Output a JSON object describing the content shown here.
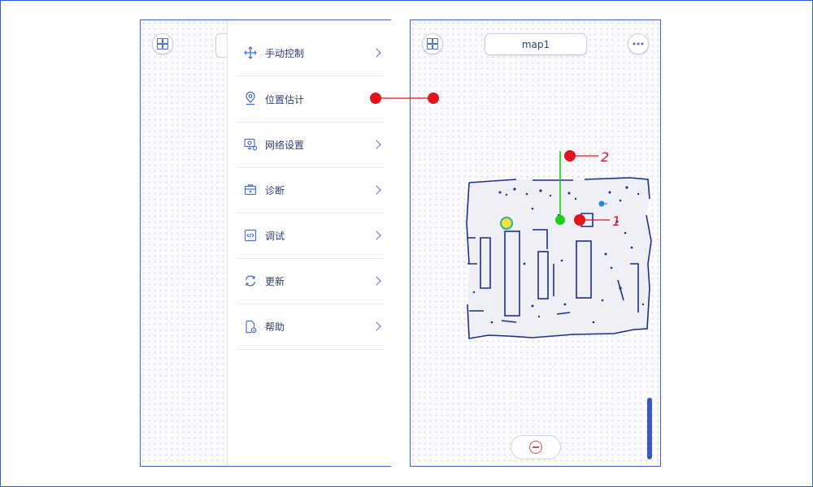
{
  "left_screen": {
    "menu": [
      {
        "label": "手动控制",
        "icon": "move-arrows-icon",
        "has_chevron": true
      },
      {
        "label": "位置估计",
        "icon": "location-pin-icon",
        "has_chevron": false
      },
      {
        "label": "网络设置",
        "icon": "network-settings-icon",
        "has_chevron": true
      },
      {
        "label": "诊断",
        "icon": "diagnosis-kit-icon",
        "has_chevron": true
      },
      {
        "label": "调试",
        "icon": "code-icon",
        "has_chevron": true
      },
      {
        "label": "更新",
        "icon": "refresh-icon",
        "has_chevron": true
      },
      {
        "label": "帮助",
        "icon": "help-document-icon",
        "has_chevron": true
      }
    ]
  },
  "right_screen": {
    "map_title": "map1"
  },
  "annotations": {
    "marker_1": "1",
    "marker_2": "2"
  },
  "colors": {
    "accent": "#4a6fd1",
    "map_wall": "#1f2e8c",
    "annotation_red": "#e3121b",
    "robot_green": "#19d119",
    "target_blue": "#2b82e0"
  }
}
